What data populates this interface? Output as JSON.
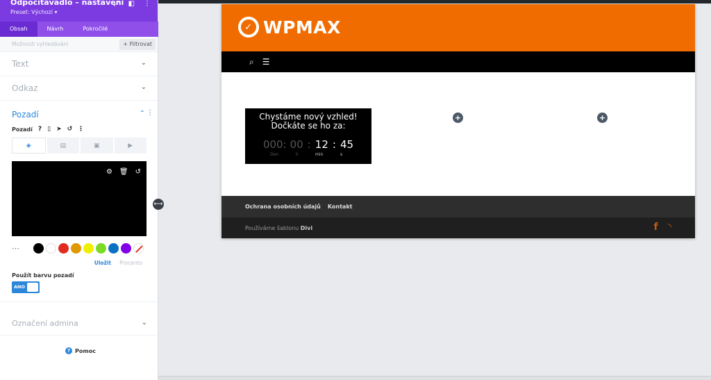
{
  "panel": {
    "title": "Odpočítávadlo – nastavení",
    "preset": "Preset: Výchozí ▾",
    "header_icons": [
      "expand-icon",
      "columns-icon",
      "more-icon"
    ],
    "tabs": [
      {
        "label": "Obsah",
        "active": true
      },
      {
        "label": "Návrh",
        "active": false
      },
      {
        "label": "Pokročilé",
        "active": false
      }
    ],
    "search_placeholder": "Možnosti vyhledávání",
    "filter_label": "+ Filtrovat",
    "sections": [
      {
        "label": "Text"
      },
      {
        "label": "Odkaz"
      }
    ],
    "background": {
      "title": "Pozadí",
      "row_label": "Pozadí",
      "row_icons": [
        "help-icon",
        "mobile-icon",
        "cursor-icon",
        "reset-icon",
        "more-icon"
      ],
      "type_tabs": [
        "color-fill-icon",
        "gradient-icon",
        "image-icon",
        "video-icon"
      ],
      "preview_color": "#000000",
      "preview_icons": [
        "gear-icon",
        "trash-icon",
        "undo-icon"
      ],
      "swatches": [
        "#000000",
        "#ffffff",
        "#e02b20",
        "#e09900",
        "#edf000",
        "#7cda24",
        "#0c71c3",
        "#8300e9"
      ],
      "save_label": "Uložit",
      "percent_label": "Procento",
      "use_bg_label": "Použít barvu pozadí",
      "toggle_label": "ANO"
    },
    "admin_label": "Označení admina",
    "help_label": "Pomoc"
  },
  "site": {
    "brand": "WPMAX",
    "accent": "#f06c00",
    "countdown": {
      "title_line1": "Chystáme nový vzhled!",
      "title_line2": "Dočkáte se ho za:",
      "days": "000:",
      "hours": "00",
      "minutes": "12",
      "seconds": "45",
      "sep_a": ":",
      "sep_b": ":",
      "label_days": "Den",
      "label_hours": "h",
      "label_minutes": "min",
      "label_seconds": "s"
    },
    "footer_links": [
      "Ochrana osobních údajů",
      "Kontakt"
    ],
    "footer_text": "Používáme šablonu",
    "footer_theme": "Divi"
  }
}
